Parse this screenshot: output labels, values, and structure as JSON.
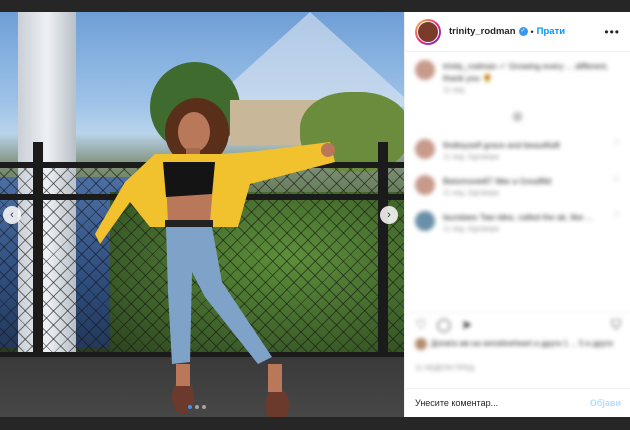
{
  "post": {
    "image_alt": "",
    "carousel": {
      "count": 3,
      "active": 1
    }
  },
  "header": {
    "username": "trinity_rodman",
    "verified_icon": "verified-badge-icon",
    "separator": "•",
    "follow_label": "Прати",
    "more_icon": "more-options-icon"
  },
  "comments": {
    "caption": {
      "text": "trinity_rodman ✓ Growing every ... different, thank you 🌻",
      "meta": "11 нед."
    },
    "items": [
      {
        "text": "findtoyself grace and beautifulll",
        "meta": "11 нед.   Одговори"
      },
      {
        "text": "Betomovie87 Ilike a Goodfild",
        "meta": "11 нед.   Одговори"
      },
      {
        "text": "lauralaes Taw idea, called the ak, like ...",
        "meta": "11 нед.   Одговори"
      }
    ],
    "load_more_icon": "load-more-icon"
  },
  "actions": {
    "like_icon": "heart-icon",
    "comment_icon": "comment-icon",
    "share_icon": "share-icon",
    "save_icon": "bookmark-icon"
  },
  "likes": {
    "text": "Допаѓа им на sensitiveheart и други 1 ... 5 и други"
  },
  "date": {
    "text": "11 НЕДЕЛИ ПРЕД"
  },
  "add_comment": {
    "placeholder": "Унесите коментар...",
    "post_label": "Објави"
  },
  "colors": {
    "accent": "#0095f6",
    "post_disabled": "#b2dffc",
    "background": "#262626"
  }
}
